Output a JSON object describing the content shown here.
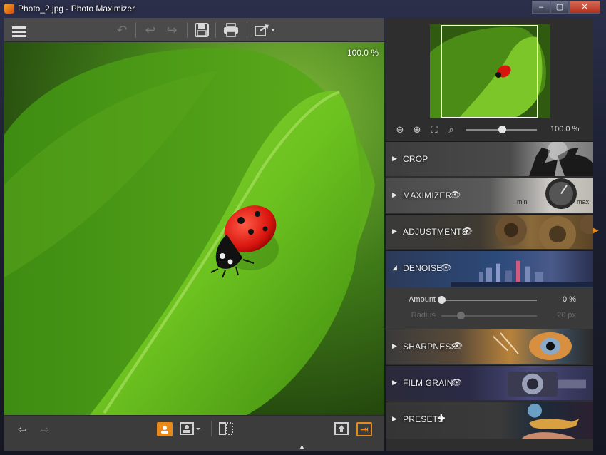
{
  "window": {
    "title": "Photo_2.jpg - Photo Maximizer",
    "controls": [
      "minimize",
      "maximize",
      "close"
    ]
  },
  "toolbar": {
    "items": [
      {
        "name": "menu-icon"
      },
      {
        "name": "revert-icon"
      },
      {
        "name": "undo-icon"
      },
      {
        "name": "redo-icon"
      },
      {
        "name": "save-icon"
      },
      {
        "name": "print-icon"
      },
      {
        "name": "share-icon"
      }
    ]
  },
  "canvas": {
    "zoom_label": "100.0 %"
  },
  "bottombar": {
    "items": [
      {
        "name": "previous-icon"
      },
      {
        "name": "next-icon"
      },
      {
        "name": "single-view-icon"
      },
      {
        "name": "compare-view-icon"
      },
      {
        "name": "split-view-icon"
      },
      {
        "name": "upload-icon"
      },
      {
        "name": "exit-icon"
      }
    ]
  },
  "navigator": {
    "zoom_value": "100.0 %",
    "zoom_level": 0.5,
    "tools": [
      "zoom-out-icon",
      "zoom-in-icon",
      "fit-icon",
      "actual-size-icon"
    ]
  },
  "sections": {
    "crop": "CROP",
    "maximizer": "MAXIMIZER",
    "maximizer_min": "min",
    "maximizer_max": "max",
    "adjustments": "ADJUSTMENTS",
    "denoise": "DENOISE",
    "sharpness": "SHARPNESS",
    "film_grain": "FILM GRAIN",
    "presets": "PRESETS"
  },
  "denoise": {
    "amount_label": "Amount",
    "amount_value": "0 %",
    "amount_level": 0.0,
    "radius_label": "Radius",
    "radius_value": "20 px",
    "radius_level": 0.2
  },
  "colors": {
    "accent": "#e8891a",
    "panel": "#2e2e2e",
    "toolbar": "#4a4a4a"
  }
}
